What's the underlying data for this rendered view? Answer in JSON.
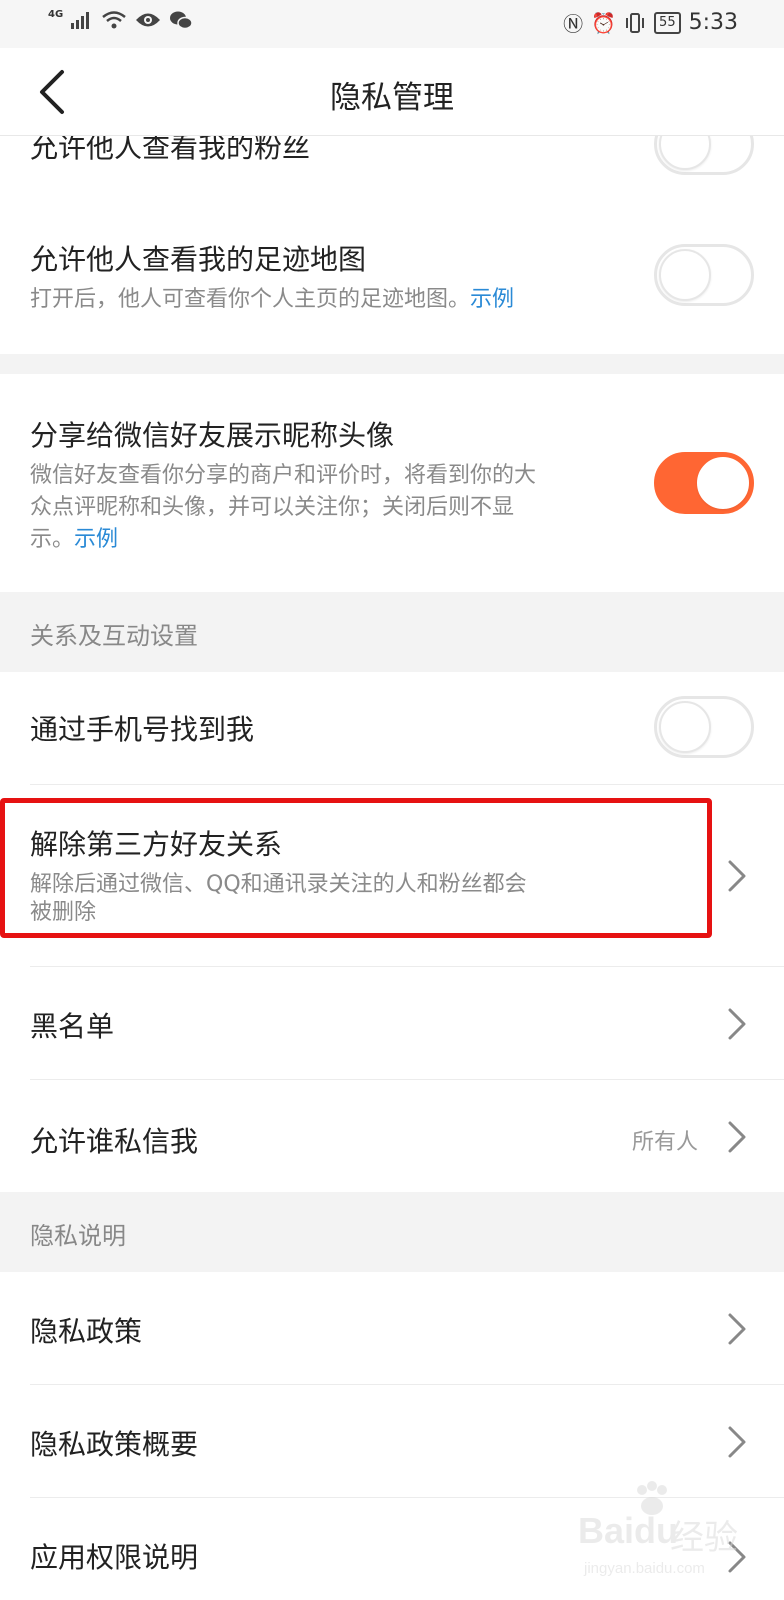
{
  "status_bar": {
    "network": "4G",
    "battery": "55",
    "time": "5:33"
  },
  "header": {
    "title": "隐私管理"
  },
  "rows_top": {
    "followers": {
      "label": "允许他人查看我的粉丝"
    },
    "footprint": {
      "label": "允许他人查看我的足迹地图",
      "desc": "打开后，他人可查看你个人主页的足迹地图。",
      "link": "示例"
    },
    "wechat_share": {
      "label": "分享给微信好友展示昵称头像",
      "desc_line1": "微信好友查看你分享的商户和评价时，将看到你的大",
      "desc_line2": "众点评昵称和头像，并可以关注你；关闭后则不显",
      "desc_line3": "示。",
      "link": "示例"
    }
  },
  "section_relations": {
    "title": "关系及互动设置",
    "find_by_phone": {
      "label": "通过手机号找到我"
    },
    "remove_third_party": {
      "label": "解除第三方好友关系",
      "desc_line1": "解除后通过微信、QQ和通讯录关注的人和粉丝都会",
      "desc_line2": "被删除"
    },
    "blacklist": {
      "label": "黑名单"
    },
    "allow_dm": {
      "label": "允许谁私信我",
      "value": "所有人"
    }
  },
  "section_privacy": {
    "title": "隐私说明",
    "policy": {
      "label": "隐私政策"
    },
    "policy_summary": {
      "label": "隐私政策概要"
    },
    "app_permissions": {
      "label": "应用权限说明"
    }
  },
  "toggles": {
    "followers": false,
    "footprint": false,
    "wechat_share": true,
    "find_by_phone": false
  },
  "colors": {
    "accent": "#ff6633",
    "link": "#2a8ad6",
    "highlight": "#e61212"
  },
  "watermark": {
    "brand": "Baidu",
    "brand_cn": "经验",
    "url": "jingyan.baidu.com"
  }
}
